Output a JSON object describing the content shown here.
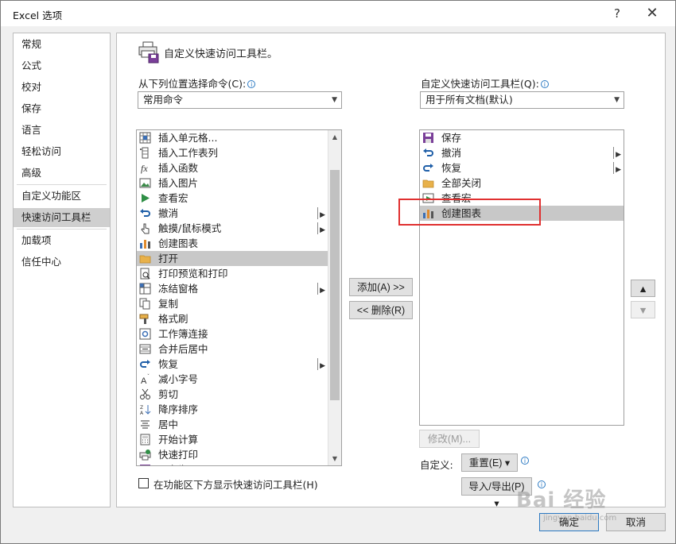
{
  "window": {
    "title": "Excel 选项",
    "help": "?",
    "close": "✕"
  },
  "nav": {
    "items": [
      "常规",
      "公式",
      "校对",
      "保存",
      "语言",
      "轻松访问",
      "高级",
      "自定义功能区",
      "快速访问工具栏",
      "加载项",
      "信任中心"
    ],
    "selected_index": 8
  },
  "section": {
    "title": "自定义快速访问工具栏。"
  },
  "left_panel": {
    "choose_label": "从下列位置选择命令(C):",
    "choose_value": "常用命令",
    "items": [
      {
        "label": "插入单元格...",
        "icon": "insert-cells-icon",
        "submenu": false
      },
      {
        "label": "插入工作表列",
        "icon": "insert-column-icon",
        "submenu": false
      },
      {
        "label": "插入函数",
        "icon": "function-icon",
        "submenu": false
      },
      {
        "label": "插入图片",
        "icon": "picture-icon",
        "submenu": false
      },
      {
        "label": "查看宏",
        "icon": "play-macro-icon",
        "submenu": false
      },
      {
        "label": "撤消",
        "icon": "undo-icon",
        "submenu": true
      },
      {
        "label": "触摸/鼠标模式",
        "icon": "touch-mode-icon",
        "submenu": true
      },
      {
        "label": "创建图表",
        "icon": "chart-icon",
        "submenu": false
      },
      {
        "label": "打开",
        "icon": "folder-icon",
        "submenu": false
      },
      {
        "label": "打印预览和打印",
        "icon": "print-preview-icon",
        "submenu": false
      },
      {
        "label": "冻结窗格",
        "icon": "freeze-panes-icon",
        "submenu": true
      },
      {
        "label": "复制",
        "icon": "copy-icon",
        "submenu": false
      },
      {
        "label": "格式刷",
        "icon": "format-painter-icon",
        "submenu": false
      },
      {
        "label": "工作簿连接",
        "icon": "connections-icon",
        "submenu": false
      },
      {
        "label": "合并后居中",
        "icon": "merge-center-icon",
        "submenu": false
      },
      {
        "label": "恢复",
        "icon": "redo-icon",
        "submenu": true
      },
      {
        "label": "减小字号",
        "icon": "decrease-font-icon",
        "submenu": false
      },
      {
        "label": "剪切",
        "icon": "cut-icon",
        "submenu": false
      },
      {
        "label": "降序排序",
        "icon": "sort-desc-icon",
        "submenu": false
      },
      {
        "label": "居中",
        "icon": "align-center-icon",
        "submenu": false
      },
      {
        "label": "开始计算",
        "icon": "calculator-icon",
        "submenu": false
      },
      {
        "label": "快速打印",
        "icon": "quick-print-icon",
        "submenu": false
      },
      {
        "label": "另存为",
        "icon": "save-as-icon",
        "submenu": false
      }
    ],
    "selected_index": 8
  },
  "right_panel": {
    "customize_label": "自定义快速访问工具栏(Q):",
    "customize_value": "用于所有文档(默认)",
    "items": [
      {
        "label": "保存",
        "icon": "save-icon",
        "submenu": false
      },
      {
        "label": "撤消",
        "icon": "undo-icon",
        "submenu": true
      },
      {
        "label": "恢复",
        "icon": "redo-icon",
        "submenu": true
      },
      {
        "label": "全部关闭",
        "icon": "folder-close-icon",
        "submenu": false
      },
      {
        "label": "查看宏",
        "icon": "macro-icon",
        "submenu": false
      },
      {
        "label": "创建图表",
        "icon": "chart-icon",
        "submenu": false
      }
    ],
    "selected_index": 5
  },
  "buttons": {
    "add": "添加(A) >>",
    "remove": "<< 删除(R)",
    "modify": "修改(M)...",
    "customize_label": "自定义:",
    "reset": "重置(E) ▾",
    "import_export": "导入/导出(P) ▾",
    "ok": "确定",
    "cancel": "取消",
    "move_up": "▲",
    "move_down": "▼"
  },
  "checkbox": {
    "label": "在功能区下方显示快速访问工具栏(H)",
    "checked": false
  },
  "watermark": {
    "text": "Bai 经验",
    "sub": "jingyan.baidu.com"
  },
  "colors": {
    "accent": "#2b79c2",
    "highlight": "#e03030",
    "selection": "#c8c8c8",
    "excel_green": "#217346"
  }
}
